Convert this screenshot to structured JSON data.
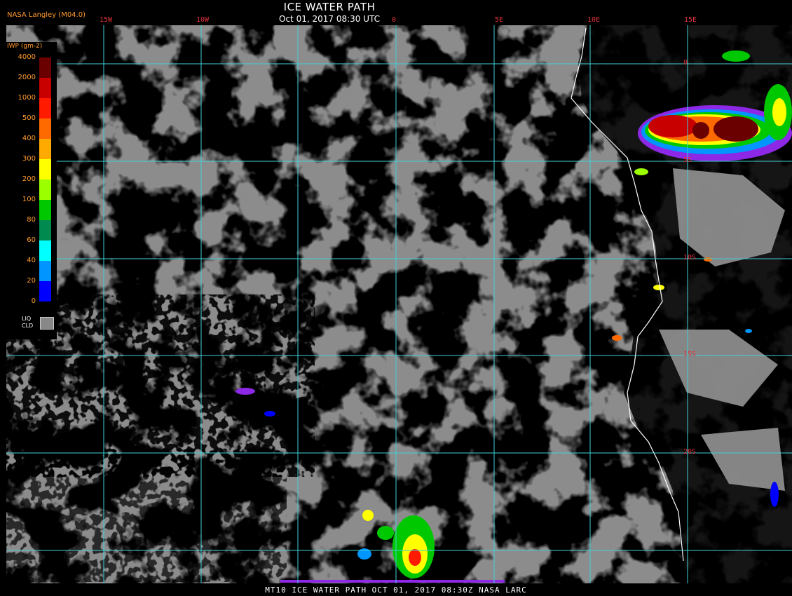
{
  "header": {
    "title": "ICE WATER PATH",
    "subtitle": "Oct 01, 2017 08:30 UTC",
    "agency": "NASA Langley (M04.0)"
  },
  "footer": {
    "caption": "MT10  ICE WATER PATH  OCT 01, 2017 08:30Z  NASA LARC"
  },
  "legend": {
    "title": "IWP (gm-2)",
    "levels": [
      {
        "label": "4000",
        "color": "#6b0000"
      },
      {
        "label": "2000",
        "color": "#c80000"
      },
      {
        "label": "1000",
        "color": "#ff1a00"
      },
      {
        "label": "500",
        "color": "#ff6a00"
      },
      {
        "label": "400",
        "color": "#ffaa00"
      },
      {
        "label": "300",
        "color": "#ffff00"
      },
      {
        "label": "200",
        "color": "#9bff00"
      },
      {
        "label": "100",
        "color": "#00c800"
      },
      {
        "label": "80",
        "color": "#008a50"
      },
      {
        "label": "60",
        "color": "#00ffff"
      },
      {
        "label": "40",
        "color": "#0095ff"
      },
      {
        "label": "20",
        "color": "#0000ff"
      },
      {
        "label": "0",
        "color": "#8c28e6"
      }
    ],
    "liq_cld_label": "LIQ\nCLD",
    "liq_cld_color": "#888888"
  },
  "grid": {
    "longitude_labels": [
      "15W",
      "10W",
      "0",
      "5E",
      "10E",
      "15E"
    ],
    "latitude_labels": [
      "0",
      "5S",
      "10S",
      "15S",
      "20S"
    ],
    "line_color": "#3fd0d8",
    "label_color": "#e0303a"
  },
  "colors": {
    "background": "#000000",
    "liquid_cloud": "#8c8c8c",
    "coastline": "#ffffff"
  }
}
